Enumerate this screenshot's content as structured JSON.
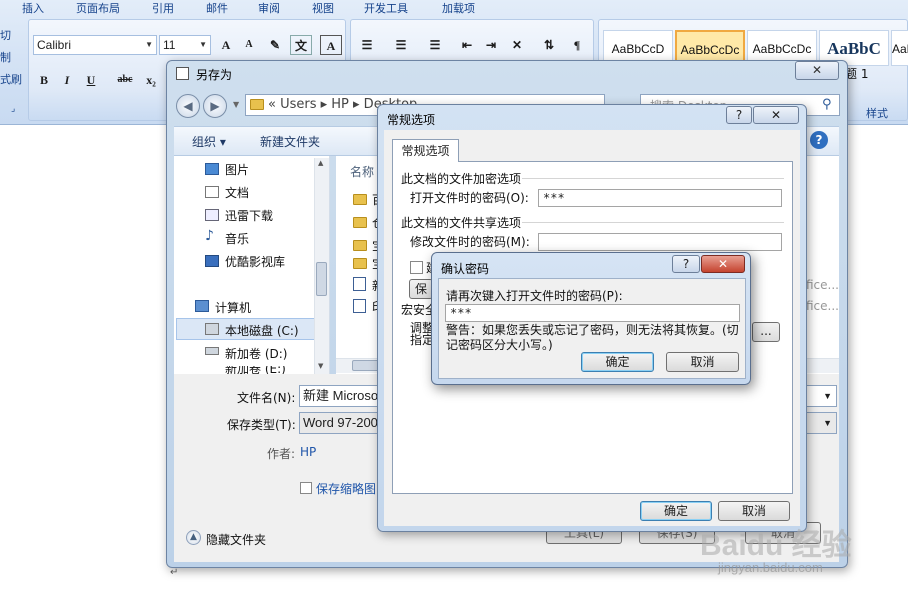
{
  "ribbon": {
    "tabs": [
      "插入",
      "页面布局",
      "引用",
      "邮件",
      "审阅",
      "视图",
      "开发工具",
      "加载项"
    ],
    "font_name": "Calibri",
    "font_size": "11",
    "left_cut": [
      "切",
      "制",
      "式刷"
    ],
    "styles": [
      "AaBbCcD",
      "AaBbCcDc",
      "AaBbCcDc",
      "AaBbC",
      "AaBb"
    ],
    "style_label": "题 1",
    "group_label": "样式"
  },
  "save_as": {
    "title": "另存为",
    "close_label": "✕",
    "breadcrumb": "«  Users  ▸  HP  ▸  Desktop",
    "search_placeholder": "搜索 Desktop",
    "toolbar": {
      "organize": "组织 ▾",
      "new_folder": "新建文件夹"
    },
    "nav_items": [
      "图片",
      "文档",
      "迅雷下载",
      "音乐",
      "优酷影视库",
      "计算机",
      "本地磁盘 (C:)",
      "新加卷 (D:)",
      "新加卷 (E:)"
    ],
    "column_name": "名称",
    "file_cut_chars": [
      "百",
      "仓",
      "宝",
      "宝",
      "新",
      "印"
    ],
    "file_side": [
      "fice...",
      "fice..."
    ],
    "file_name_label": "文件名(N):",
    "file_name_value": "新建 Microsoft Word 文档",
    "save_type_label": "保存类型(T):",
    "save_type_value": "Word 97-2003 文档",
    "author_label": "作者:",
    "author_value": "HP",
    "thumbnail_label": "保存缩略图",
    "hide_folders": "隐藏文件夹",
    "tools_button": "工具(L)",
    "save_button": "保存(S)",
    "cancel_button": "取消"
  },
  "general_options": {
    "title": "常规选项",
    "help_label": "?",
    "close_label": "✕",
    "tab": "常规选项",
    "encrypt_section": "此文档的文件加密选项",
    "open_password_label": "打开文件时的密码(O):",
    "open_password_value": "***",
    "share_section": "此文档的文件共享选项",
    "modify_password_label": "修改文件时的密码(M):",
    "modify_password_value": "",
    "readonly_cut": "建",
    "protect_cut": "保",
    "macro_section_cut": "宏安全",
    "macro_line1_cut": "调整",
    "macro_line2_cut": "指定",
    "macro_button_cut": "...",
    "ok": "确定",
    "cancel": "取消"
  },
  "confirm_password": {
    "title": "确认密码",
    "help_label": "?",
    "close_label": "✕",
    "prompt": "请再次键入打开文件时的密码(P):",
    "input_value": "***",
    "warning": "警告：如果您丢失或忘记了密码，则无法将其恢复。(切记密码区分大小写。)",
    "ok": "确定",
    "cancel": "取消"
  },
  "watermark": {
    "brand": "Baidu 经验",
    "url": "jingyan.baidu.com"
  },
  "colors": {
    "ribbon_bg": "#d5e3f5",
    "dialog_frame": "#c3d6ec",
    "close_red": "#c5432f",
    "link_blue": "#1f55a9"
  }
}
